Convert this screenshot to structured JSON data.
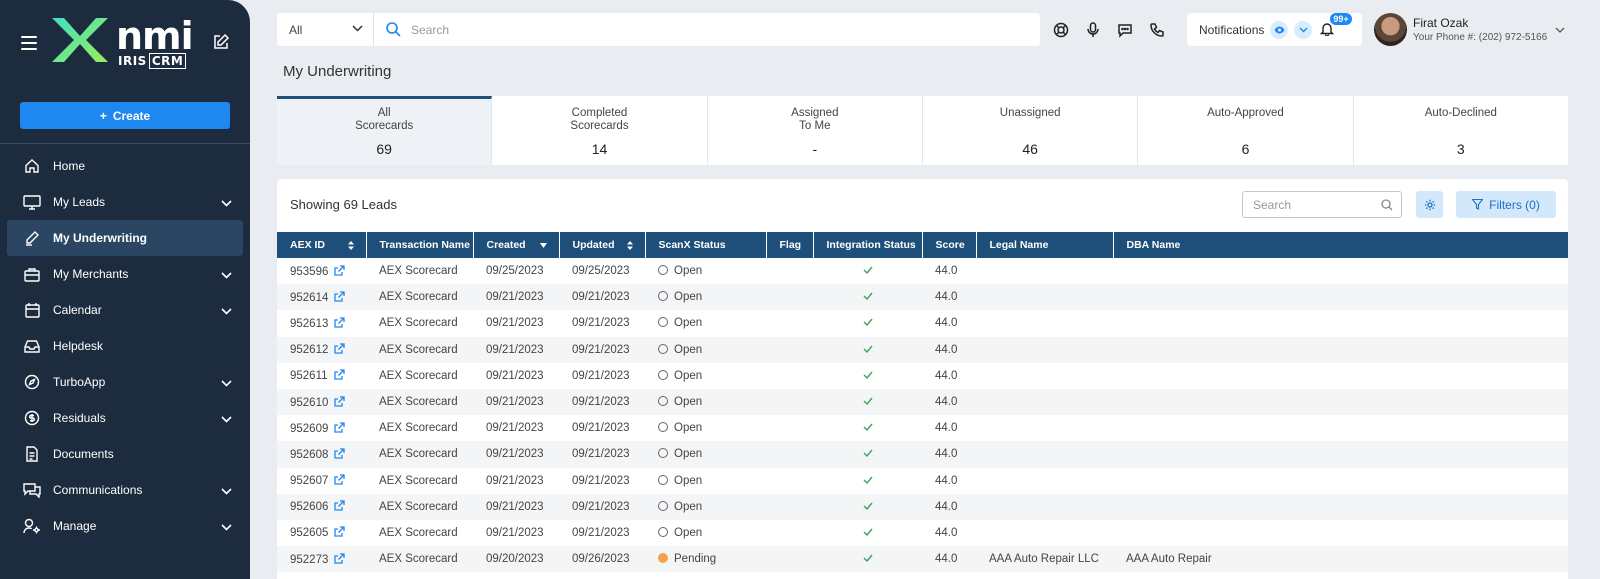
{
  "sidebar": {
    "logo": {
      "brand": "nmi",
      "sub_left": "IRIS",
      "sub_right": "CRM"
    },
    "create_label": "Create",
    "items": [
      {
        "label": "Home",
        "icon": "home-icon",
        "chevron": false,
        "active": false
      },
      {
        "label": "My Leads",
        "icon": "monitor-icon",
        "chevron": true,
        "active": false
      },
      {
        "label": "My Underwriting",
        "icon": "pen-icon",
        "chevron": false,
        "active": true
      },
      {
        "label": "My Merchants",
        "icon": "briefcase-icon",
        "chevron": true,
        "active": false
      },
      {
        "label": "Calendar",
        "icon": "calendar-icon",
        "chevron": true,
        "active": false
      },
      {
        "label": "Helpdesk",
        "icon": "inbox-icon",
        "chevron": false,
        "active": false
      },
      {
        "label": "TurboApp",
        "icon": "compass-icon",
        "chevron": true,
        "active": false
      },
      {
        "label": "Residuals",
        "icon": "dollar-icon",
        "chevron": true,
        "active": false
      },
      {
        "label": "Documents",
        "icon": "document-icon",
        "chevron": false,
        "active": false
      },
      {
        "label": "Communications",
        "icon": "chat-icon",
        "chevron": true,
        "active": false
      },
      {
        "label": "Manage",
        "icon": "user-gear-icon",
        "chevron": true,
        "active": false
      }
    ]
  },
  "topbar": {
    "scope_select": "All",
    "search_placeholder": "Search",
    "notifications_label": "Notifications",
    "notifications_badge": "99+",
    "user_name": "Firat Ozak",
    "user_phone": "Your Phone #: (202) 972-5166"
  },
  "page": {
    "title": "My Underwriting"
  },
  "stats": [
    {
      "label": "All\nScorecards",
      "value": "69",
      "active": true
    },
    {
      "label": "Completed\nScorecards",
      "value": "14",
      "active": false
    },
    {
      "label": "Assigned\nTo Me",
      "value": "-",
      "active": false
    },
    {
      "label": "Unassigned",
      "value": "46",
      "active": false
    },
    {
      "label": "Auto-Approved",
      "value": "6",
      "active": false
    },
    {
      "label": "Auto-Declined",
      "value": "3",
      "active": false
    }
  ],
  "table": {
    "showing": "Showing 69 Leads",
    "search_placeholder": "Search",
    "filters_label": "Filters (0)",
    "columns": [
      "AEX ID",
      "Transaction Name",
      "Created",
      "Updated",
      "ScanX Status",
      "Flag",
      "Integration Status",
      "Score",
      "Legal Name",
      "DBA Name"
    ],
    "rows": [
      {
        "id": "953596",
        "name": "AEX Scorecard",
        "created": "09/25/2023",
        "updated": "09/25/2023",
        "status": "Open",
        "flag": "",
        "score": "44.0",
        "legal": "",
        "dba": ""
      },
      {
        "id": "952614",
        "name": "AEX Scorecard",
        "created": "09/21/2023",
        "updated": "09/21/2023",
        "status": "Open",
        "flag": "",
        "score": "44.0",
        "legal": "",
        "dba": ""
      },
      {
        "id": "952613",
        "name": "AEX Scorecard",
        "created": "09/21/2023",
        "updated": "09/21/2023",
        "status": "Open",
        "flag": "",
        "score": "44.0",
        "legal": "",
        "dba": ""
      },
      {
        "id": "952612",
        "name": "AEX Scorecard",
        "created": "09/21/2023",
        "updated": "09/21/2023",
        "status": "Open",
        "flag": "",
        "score": "44.0",
        "legal": "",
        "dba": ""
      },
      {
        "id": "952611",
        "name": "AEX Scorecard",
        "created": "09/21/2023",
        "updated": "09/21/2023",
        "status": "Open",
        "flag": "",
        "score": "44.0",
        "legal": "",
        "dba": ""
      },
      {
        "id": "952610",
        "name": "AEX Scorecard",
        "created": "09/21/2023",
        "updated": "09/21/2023",
        "status": "Open",
        "flag": "",
        "score": "44.0",
        "legal": "",
        "dba": ""
      },
      {
        "id": "952609",
        "name": "AEX Scorecard",
        "created": "09/21/2023",
        "updated": "09/21/2023",
        "status": "Open",
        "flag": "",
        "score": "44.0",
        "legal": "",
        "dba": ""
      },
      {
        "id": "952608",
        "name": "AEX Scorecard",
        "created": "09/21/2023",
        "updated": "09/21/2023",
        "status": "Open",
        "flag": "",
        "score": "44.0",
        "legal": "",
        "dba": ""
      },
      {
        "id": "952607",
        "name": "AEX Scorecard",
        "created": "09/21/2023",
        "updated": "09/21/2023",
        "status": "Open",
        "flag": "",
        "score": "44.0",
        "legal": "",
        "dba": ""
      },
      {
        "id": "952606",
        "name": "AEX Scorecard",
        "created": "09/21/2023",
        "updated": "09/21/2023",
        "status": "Open",
        "flag": "",
        "score": "44.0",
        "legal": "",
        "dba": ""
      },
      {
        "id": "952605",
        "name": "AEX Scorecard",
        "created": "09/21/2023",
        "updated": "09/21/2023",
        "status": "Open",
        "flag": "",
        "score": "44.0",
        "legal": "",
        "dba": ""
      },
      {
        "id": "952273",
        "name": "AEX Scorecard",
        "created": "09/20/2023",
        "updated": "09/26/2023",
        "status": "Pending",
        "flag": "",
        "score": "44.0",
        "legal": "AAA Auto Repair LLC",
        "dba": "AAA Auto Repair"
      }
    ]
  },
  "colors": {
    "sidebar": "#1d2b3e",
    "accent": "#1e88f0",
    "table_header": "#1d4f7a",
    "pending": "#f5a04a",
    "check": "#3aa35c",
    "logo_green": "#7be07b"
  }
}
